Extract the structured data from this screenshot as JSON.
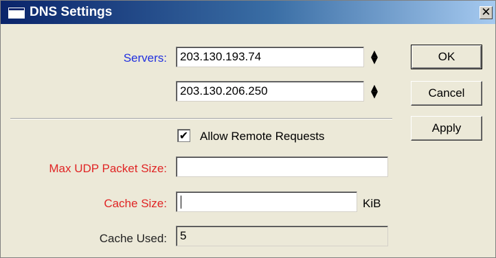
{
  "window": {
    "title": "DNS Settings",
    "close_glyph": "✕",
    "icon": "window-icon"
  },
  "servers": {
    "label": "Servers:",
    "entries": [
      "203.130.193.74",
      "203.130.206.250"
    ],
    "spinner_up": "▲",
    "spinner_down": "▼"
  },
  "allow_remote": {
    "label": "Allow Remote Requests",
    "checked": true,
    "check_glyph": "✔"
  },
  "max_udp": {
    "label": "Max UDP Packet Size:",
    "value": ""
  },
  "cache_size": {
    "label": "Cache Size:",
    "value": "",
    "unit": "KiB"
  },
  "cache_used": {
    "label": "Cache Used:",
    "value": "5"
  },
  "buttons": {
    "ok": "OK",
    "cancel": "Cancel",
    "apply": "Apply"
  },
  "colors": {
    "title_gradient_start": "#0a246a",
    "title_gradient_end": "#a6caf0",
    "servers_label": "#1f2fdf",
    "required_label": "#e02424",
    "dialog_bg": "#ece9d8"
  }
}
